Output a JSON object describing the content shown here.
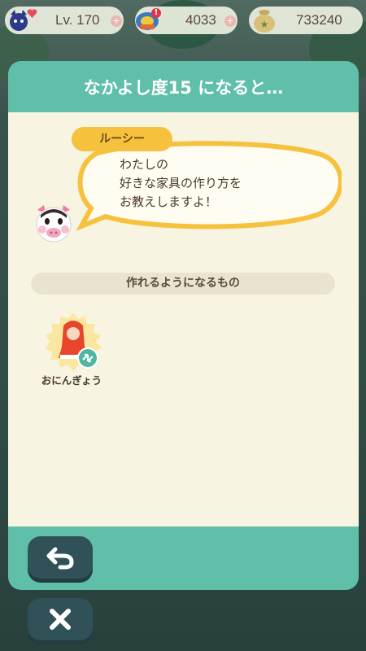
{
  "status_bar": {
    "level": "Lv. 170",
    "leaf_tickets": "4033",
    "bells": "733240",
    "icons": [
      "cat-friend-icon",
      "heart-icon",
      "leaf-ticket-icon",
      "notification-badge-icon",
      "bell-bag-icon",
      "plus-icon"
    ]
  },
  "dialog": {
    "title": "なかよし度15 になると…",
    "speaker": "ルーシー",
    "message_lines": [
      "わたしの",
      "好きな家具の作り方を",
      "お教えしますよ！"
    ],
    "section_label": "作れるようになるもの",
    "items": [
      {
        "name": "おにんぎょう",
        "icon": "doll-icon"
      }
    ]
  },
  "buttons": {
    "back_icon": "back-arrow-icon",
    "close_icon": "close-icon"
  },
  "colors": {
    "modal_teal": "#5fbfa9",
    "paper": "#f8f4e2",
    "speaker_yellow": "#f6c23e",
    "button_dark": "#2f5157"
  }
}
